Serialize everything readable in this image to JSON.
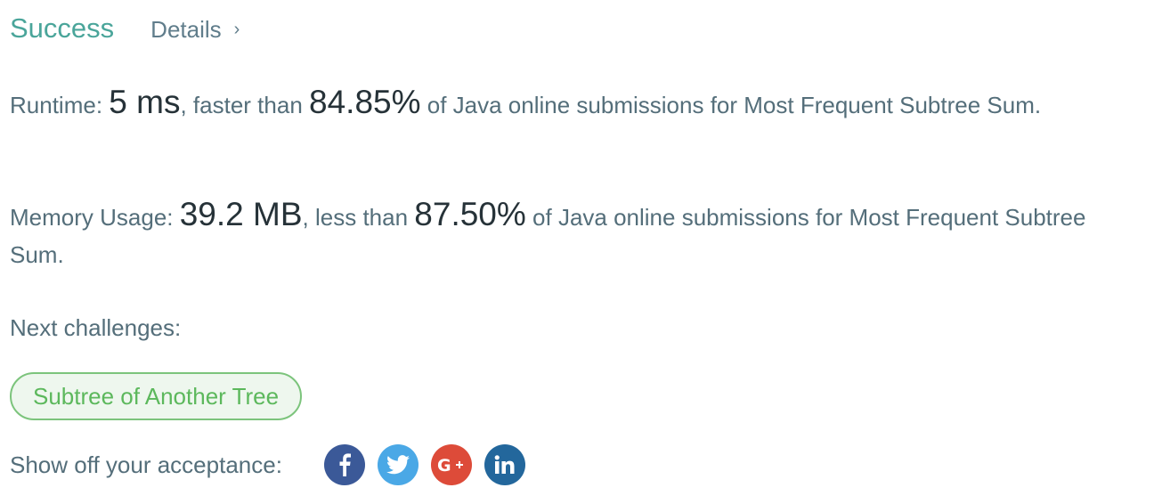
{
  "header": {
    "status": "Success",
    "details_label": "Details",
    "chevron": "›"
  },
  "runtime": {
    "label": "Runtime:",
    "value": "5 ms",
    "comparison": "faster than",
    "percent": "84.85%",
    "suffix": "of Java online submissions for Most Frequent Subtree Sum."
  },
  "memory": {
    "label": "Memory Usage:",
    "value": "39.2 MB",
    "comparison": "less than",
    "percent": "87.50%",
    "suffix": "of Java online submissions for Most Frequent Subtree Sum."
  },
  "next": {
    "label": "Next challenges:",
    "challenges": [
      "Subtree of Another Tree"
    ]
  },
  "share": {
    "label": "Show off your acceptance:",
    "icons": [
      {
        "name": "facebook-icon",
        "color": "#3b5998"
      },
      {
        "name": "twitter-icon",
        "color": "#4aa8e6"
      },
      {
        "name": "google-plus-icon",
        "color": "#dd4b39"
      },
      {
        "name": "linkedin-icon",
        "color": "#23679c"
      }
    ]
  },
  "colors": {
    "success": "#4aa59a",
    "text": "#546e7a",
    "emphasis": "#263238",
    "challenge_border": "#7cc47c",
    "challenge_text": "#5cb85c"
  }
}
